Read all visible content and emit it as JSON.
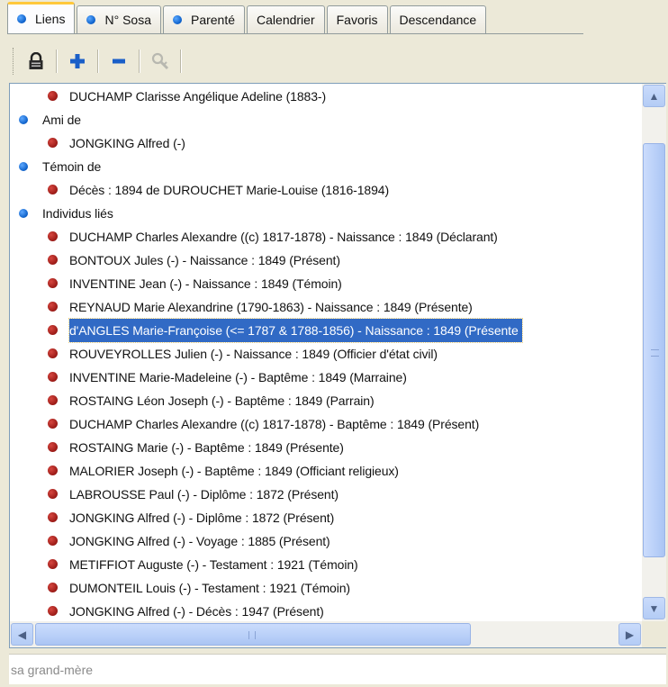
{
  "tabs": [
    {
      "label": "Liens",
      "dot": true,
      "active": true
    },
    {
      "label": "N° Sosa",
      "dot": true,
      "active": false
    },
    {
      "label": "Parenté",
      "dot": true,
      "active": false
    },
    {
      "label": "Calendrier",
      "dot": false,
      "active": false
    },
    {
      "label": "Favoris",
      "dot": false,
      "active": false
    },
    {
      "label": "Descendance",
      "dot": false,
      "active": false
    }
  ],
  "toolbar": {
    "lock": "🔒",
    "add": "+",
    "remove": "−",
    "link_disabled": "✎"
  },
  "list": {
    "rows": [
      {
        "level": 2,
        "text": "DUCHAMP Clarisse Angélique Adeline (1883-)",
        "selected": false
      },
      {
        "level": 1,
        "text": "Ami de",
        "selected": false
      },
      {
        "level": 2,
        "text": "JONGKING Alfred (-)",
        "selected": false
      },
      {
        "level": 1,
        "text": "Témoin de",
        "selected": false
      },
      {
        "level": 2,
        "text": "Décès : 1894 de DUROUCHET Marie-Louise (1816-1894)",
        "selected": false
      },
      {
        "level": 1,
        "text": "Individus liés",
        "selected": false
      },
      {
        "level": 2,
        "text": "DUCHAMP Charles Alexandre ((c) 1817-1878) - Naissance : 1849 (Déclarant)",
        "selected": false
      },
      {
        "level": 2,
        "text": "BONTOUX Jules (-) - Naissance : 1849 (Présent)",
        "selected": false
      },
      {
        "level": 2,
        "text": "INVENTINE Jean (-) - Naissance : 1849 (Témoin)",
        "selected": false
      },
      {
        "level": 2,
        "text": "REYNAUD Marie Alexandrine (1790-1863) - Naissance : 1849 (Présente)",
        "selected": false
      },
      {
        "level": 2,
        "text": "d'ANGLES Marie-Françoise (<= 1787 & 1788-1856) - Naissance : 1849 (Présente",
        "selected": true
      },
      {
        "level": 2,
        "text": "ROUVEYROLLES Julien (-) - Naissance : 1849 (Officier d'état civil)",
        "selected": false
      },
      {
        "level": 2,
        "text": "INVENTINE Marie-Madeleine (-) - Baptême : 1849 (Marraine)",
        "selected": false
      },
      {
        "level": 2,
        "text": "ROSTAING Léon Joseph (-) - Baptême : 1849 (Parrain)",
        "selected": false
      },
      {
        "level": 2,
        "text": "DUCHAMP Charles Alexandre ((c) 1817-1878) - Baptême : 1849 (Présent)",
        "selected": false
      },
      {
        "level": 2,
        "text": "ROSTAING Marie (-) - Baptême : 1849 (Présente)",
        "selected": false
      },
      {
        "level": 2,
        "text": "MALORIER Joseph (-) - Baptême : 1849 (Officiant religieux)",
        "selected": false
      },
      {
        "level": 2,
        "text": "LABROUSSE Paul (-) - Diplôme : 1872 (Présent)",
        "selected": false
      },
      {
        "level": 2,
        "text": "JONGKING Alfred (-) - Diplôme : 1872 (Présent)",
        "selected": false
      },
      {
        "level": 2,
        "text": "JONGKING Alfred (-) - Voyage : 1885 (Présent)",
        "selected": false
      },
      {
        "level": 2,
        "text": "METIFFIOT Auguste (-) - Testament : 1921 (Témoin)",
        "selected": false
      },
      {
        "level": 2,
        "text": "DUMONTEIL Louis (-) - Testament : 1921 (Témoin)",
        "selected": false
      },
      {
        "level": 2,
        "text": "JONGKING Alfred (-) - Décès : 1947 (Présent)",
        "selected": false
      }
    ]
  },
  "scrollbars": {
    "up_arrow": "▲",
    "down_arrow": "▼",
    "left_arrow": "◀",
    "right_arrow": "▶"
  },
  "status": {
    "text": "sa grand-mère"
  },
  "colors": {
    "selection": "#316ac5",
    "node_blue": "#0c5fc8",
    "node_red": "#9a1a16",
    "tab_highlight": "#ffc83c"
  }
}
